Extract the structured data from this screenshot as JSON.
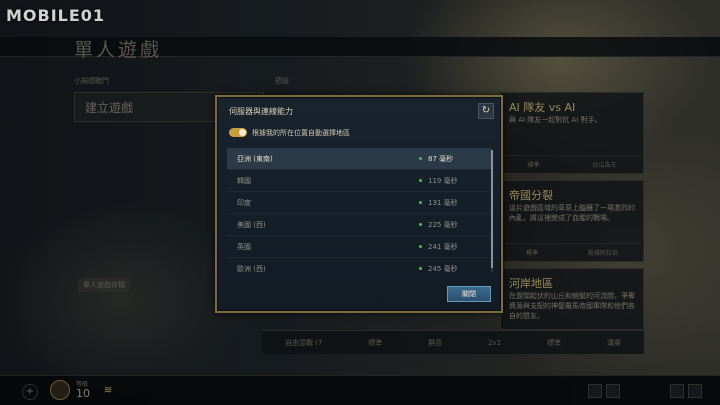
{
  "watermark": "MOBILE01",
  "page_title": "單人遊戲",
  "left_panel": {
    "section_label": "小規模戰鬥",
    "create_game_label": "建立遊戲",
    "single_player_list_label": "單人遊戲存檔"
  },
  "predefined_label": "預設",
  "cards": [
    {
      "title": "AI 隊友 vs AI",
      "desc": "與 AI 隊友一起對抗 AI 對手。",
      "foot": [
        "標準",
        "佔山為王"
      ]
    },
    {
      "title": "帝國分裂",
      "desc": "這片遊戲區域的草原上醞釀了一場激烈的內亂，將這裡變成了血腥的戰場。",
      "foot": [
        "標準",
        "乾燥阿拉伯"
      ]
    },
    {
      "title": "河岸地區",
      "desc": "在遼闊起伏的山丘和蜿蜒的河流間，爭奪資源與支配的神聖羅馬帝國軍隊和他們各自的盟友。",
      "foot": []
    }
  ],
  "bottom_strip": [
    "自由混戰 (7",
    "標準",
    "群島",
    "2v2",
    "標準",
    "溝渠"
  ],
  "footer": {
    "level_label": "等級",
    "level_value": "10"
  },
  "dialog": {
    "title": "伺服器與連線能力",
    "auto_select_label": "根據我的所在位置自動選擇地區",
    "auto_select_on": true,
    "servers": [
      {
        "name": "亞洲 (東南)",
        "ping": "87 毫秒",
        "selected": true
      },
      {
        "name": "韓國",
        "ping": "119 毫秒",
        "selected": false
      },
      {
        "name": "印度",
        "ping": "131 毫秒",
        "selected": false
      },
      {
        "name": "美國 (西)",
        "ping": "225 毫秒",
        "selected": false
      },
      {
        "name": "英國",
        "ping": "241 毫秒",
        "selected": false
      },
      {
        "name": "歐洲 (西)",
        "ping": "245 毫秒",
        "selected": false
      }
    ],
    "close_label": "關閉"
  },
  "colors": {
    "dialog_border": "#7d6a3d",
    "toggle_on": "#c9a03c",
    "ping_good": "#42c24f",
    "close_button": "#2b5072",
    "selected_row": "#2a3a48"
  }
}
